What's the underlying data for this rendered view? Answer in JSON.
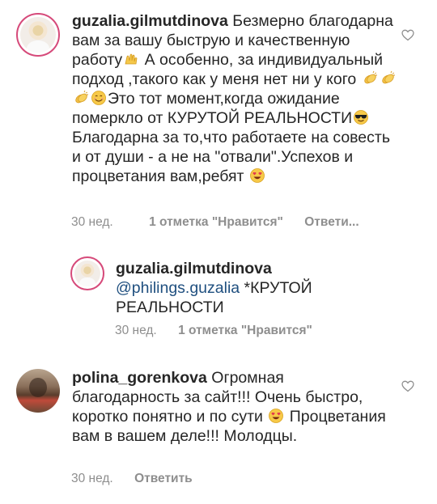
{
  "comments": [
    {
      "username": "guzalia.gilmutdinova",
      "text_parts": [
        " Безмерно благодарна вам за вашу быструю и качественную работу",
        " А особенно, за индивидуальный подход ,такого как у меня нет ни у кого ",
        "Это тот момент,когда ожидание померкло от КУРУТОЙ РЕАЛЬНОСТИ",
        "Благодарна за то,что работаете на совесть и от души - а не на \"отвали\".Успехов и процветания вам,ребят "
      ],
      "time": "30 нед.",
      "likes": "1 отметка \"Нравится\"",
      "reply": "Ответи..."
    },
    {
      "username": "guzalia.gilmutdinova",
      "mention": "@philings.guzalia",
      "text": " *КРУТОЙ РЕАЛЬНОСТИ",
      "time": "30 нед.",
      "likes": "1 отметка \"Нравится\""
    },
    {
      "username": "polina_gorenkova",
      "text_parts": [
        " Огромная благодарность за сайт!!! Очень быстро, коротко понятно и по сути ",
        " Процветания вам в вашем деле!!! Молодцы."
      ],
      "time": "30 нед.",
      "reply": "Ответить"
    }
  ],
  "icons": {
    "like": "heart-outline-icon",
    "emoji_hands": "raising-hands-emoji",
    "emoji_clap": "clapping-hands-emoji",
    "emoji_smile": "smiling-face-emoji",
    "emoji_sunglasses": "sunglasses-face-emoji",
    "emoji_hearteyes": "heart-eyes-emoji"
  },
  "colors": {
    "text": "#262626",
    "meta": "#8e8e8e",
    "mention": "#1f4f7f",
    "ring": "#d64a7a"
  }
}
